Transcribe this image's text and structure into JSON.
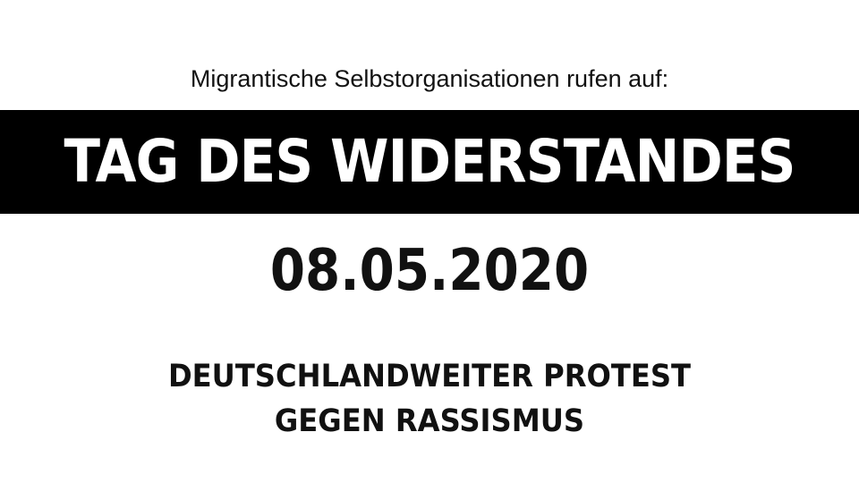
{
  "poster": {
    "intro": "Migrantische Selbstorganisationen rufen auf:",
    "headline": "TAG DES WIDERSTANDES",
    "date": "08.05.2020",
    "protest_lines": [
      "DEUTSCHLANDWEITER PROTEST",
      "GEGEN RASSISMUS"
    ]
  },
  "colors": {
    "background": "#ffffff",
    "banner": "#000000",
    "banner_text": "#ffffff",
    "text": "#111111"
  }
}
